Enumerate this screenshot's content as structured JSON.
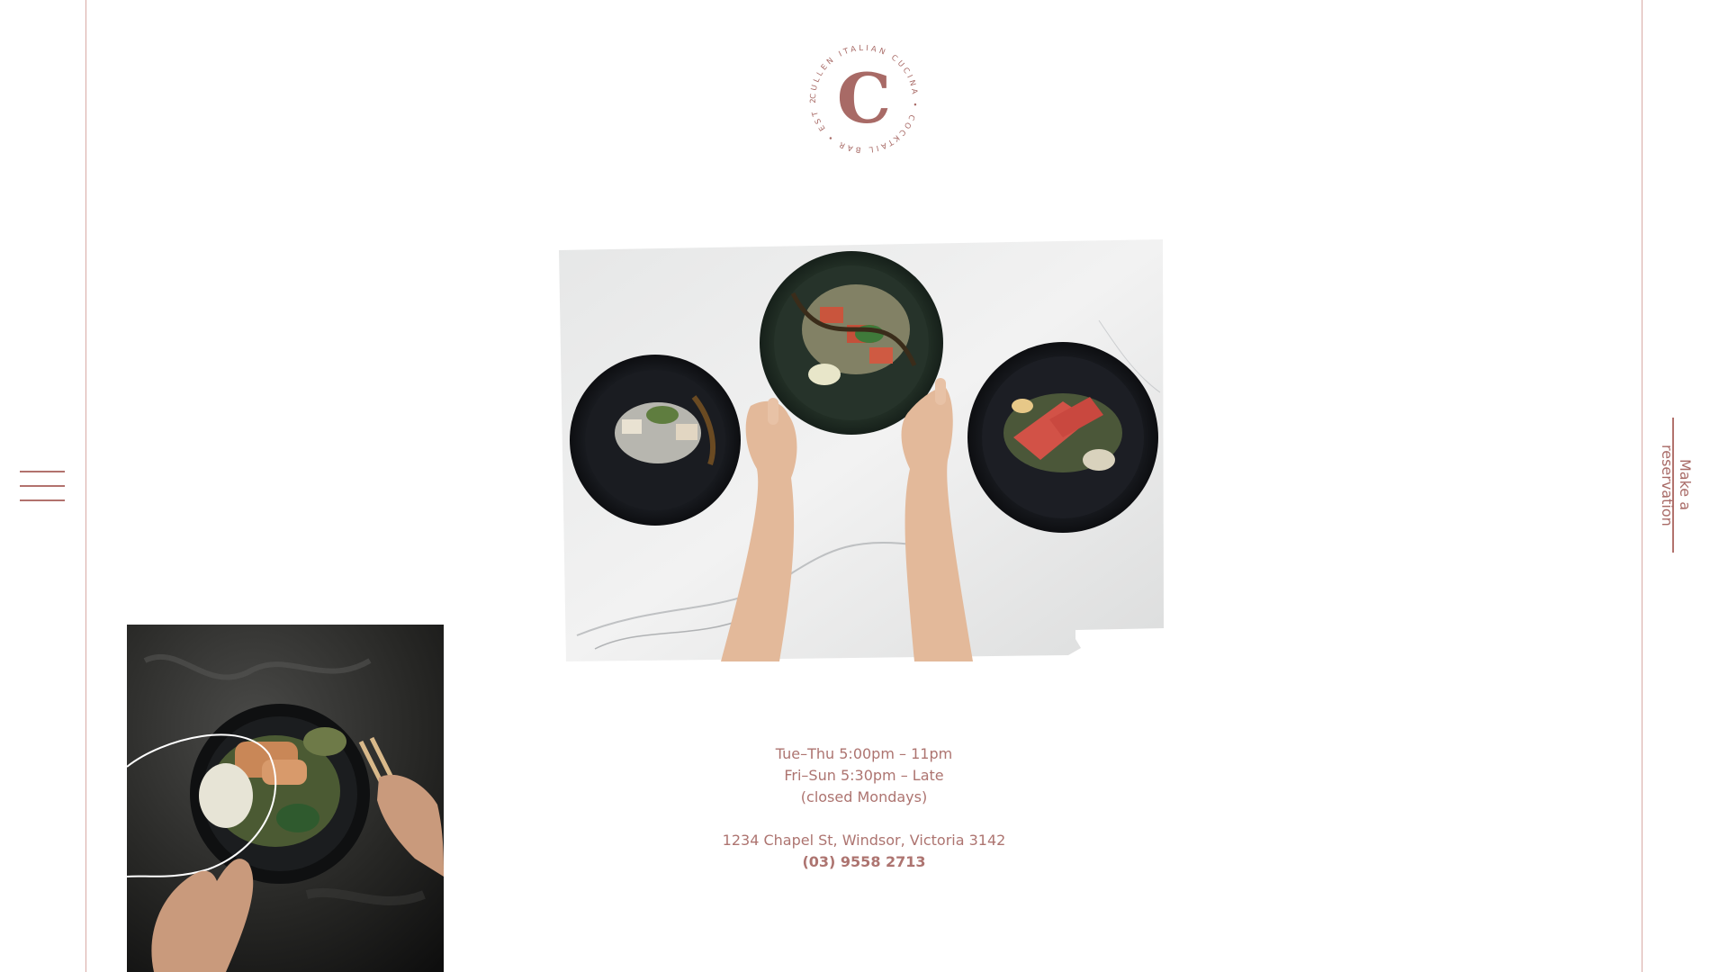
{
  "logo": {
    "letter": "C",
    "ring_text": "CULLEN ITALIAN CUCINA • COCKTAIL BAR • EST 2008 •"
  },
  "hours": {
    "line1": "Tue–Thu 5:00pm – 11pm",
    "line2": "Fri–Sun 5:30pm – Late",
    "line3": "(closed Mondays)"
  },
  "contact": {
    "address": "1234 Chapel St, Windsor, Victoria 3142",
    "phone": "(03) 9558 2713"
  },
  "reservation": {
    "label": "Make a reservation"
  },
  "colors": {
    "brand": "#a86a66",
    "rule": "#d8aaa5",
    "marble": "#eceded",
    "plate_dark": "#1d1f24"
  },
  "icons": {
    "menu": "hamburger-icon"
  }
}
